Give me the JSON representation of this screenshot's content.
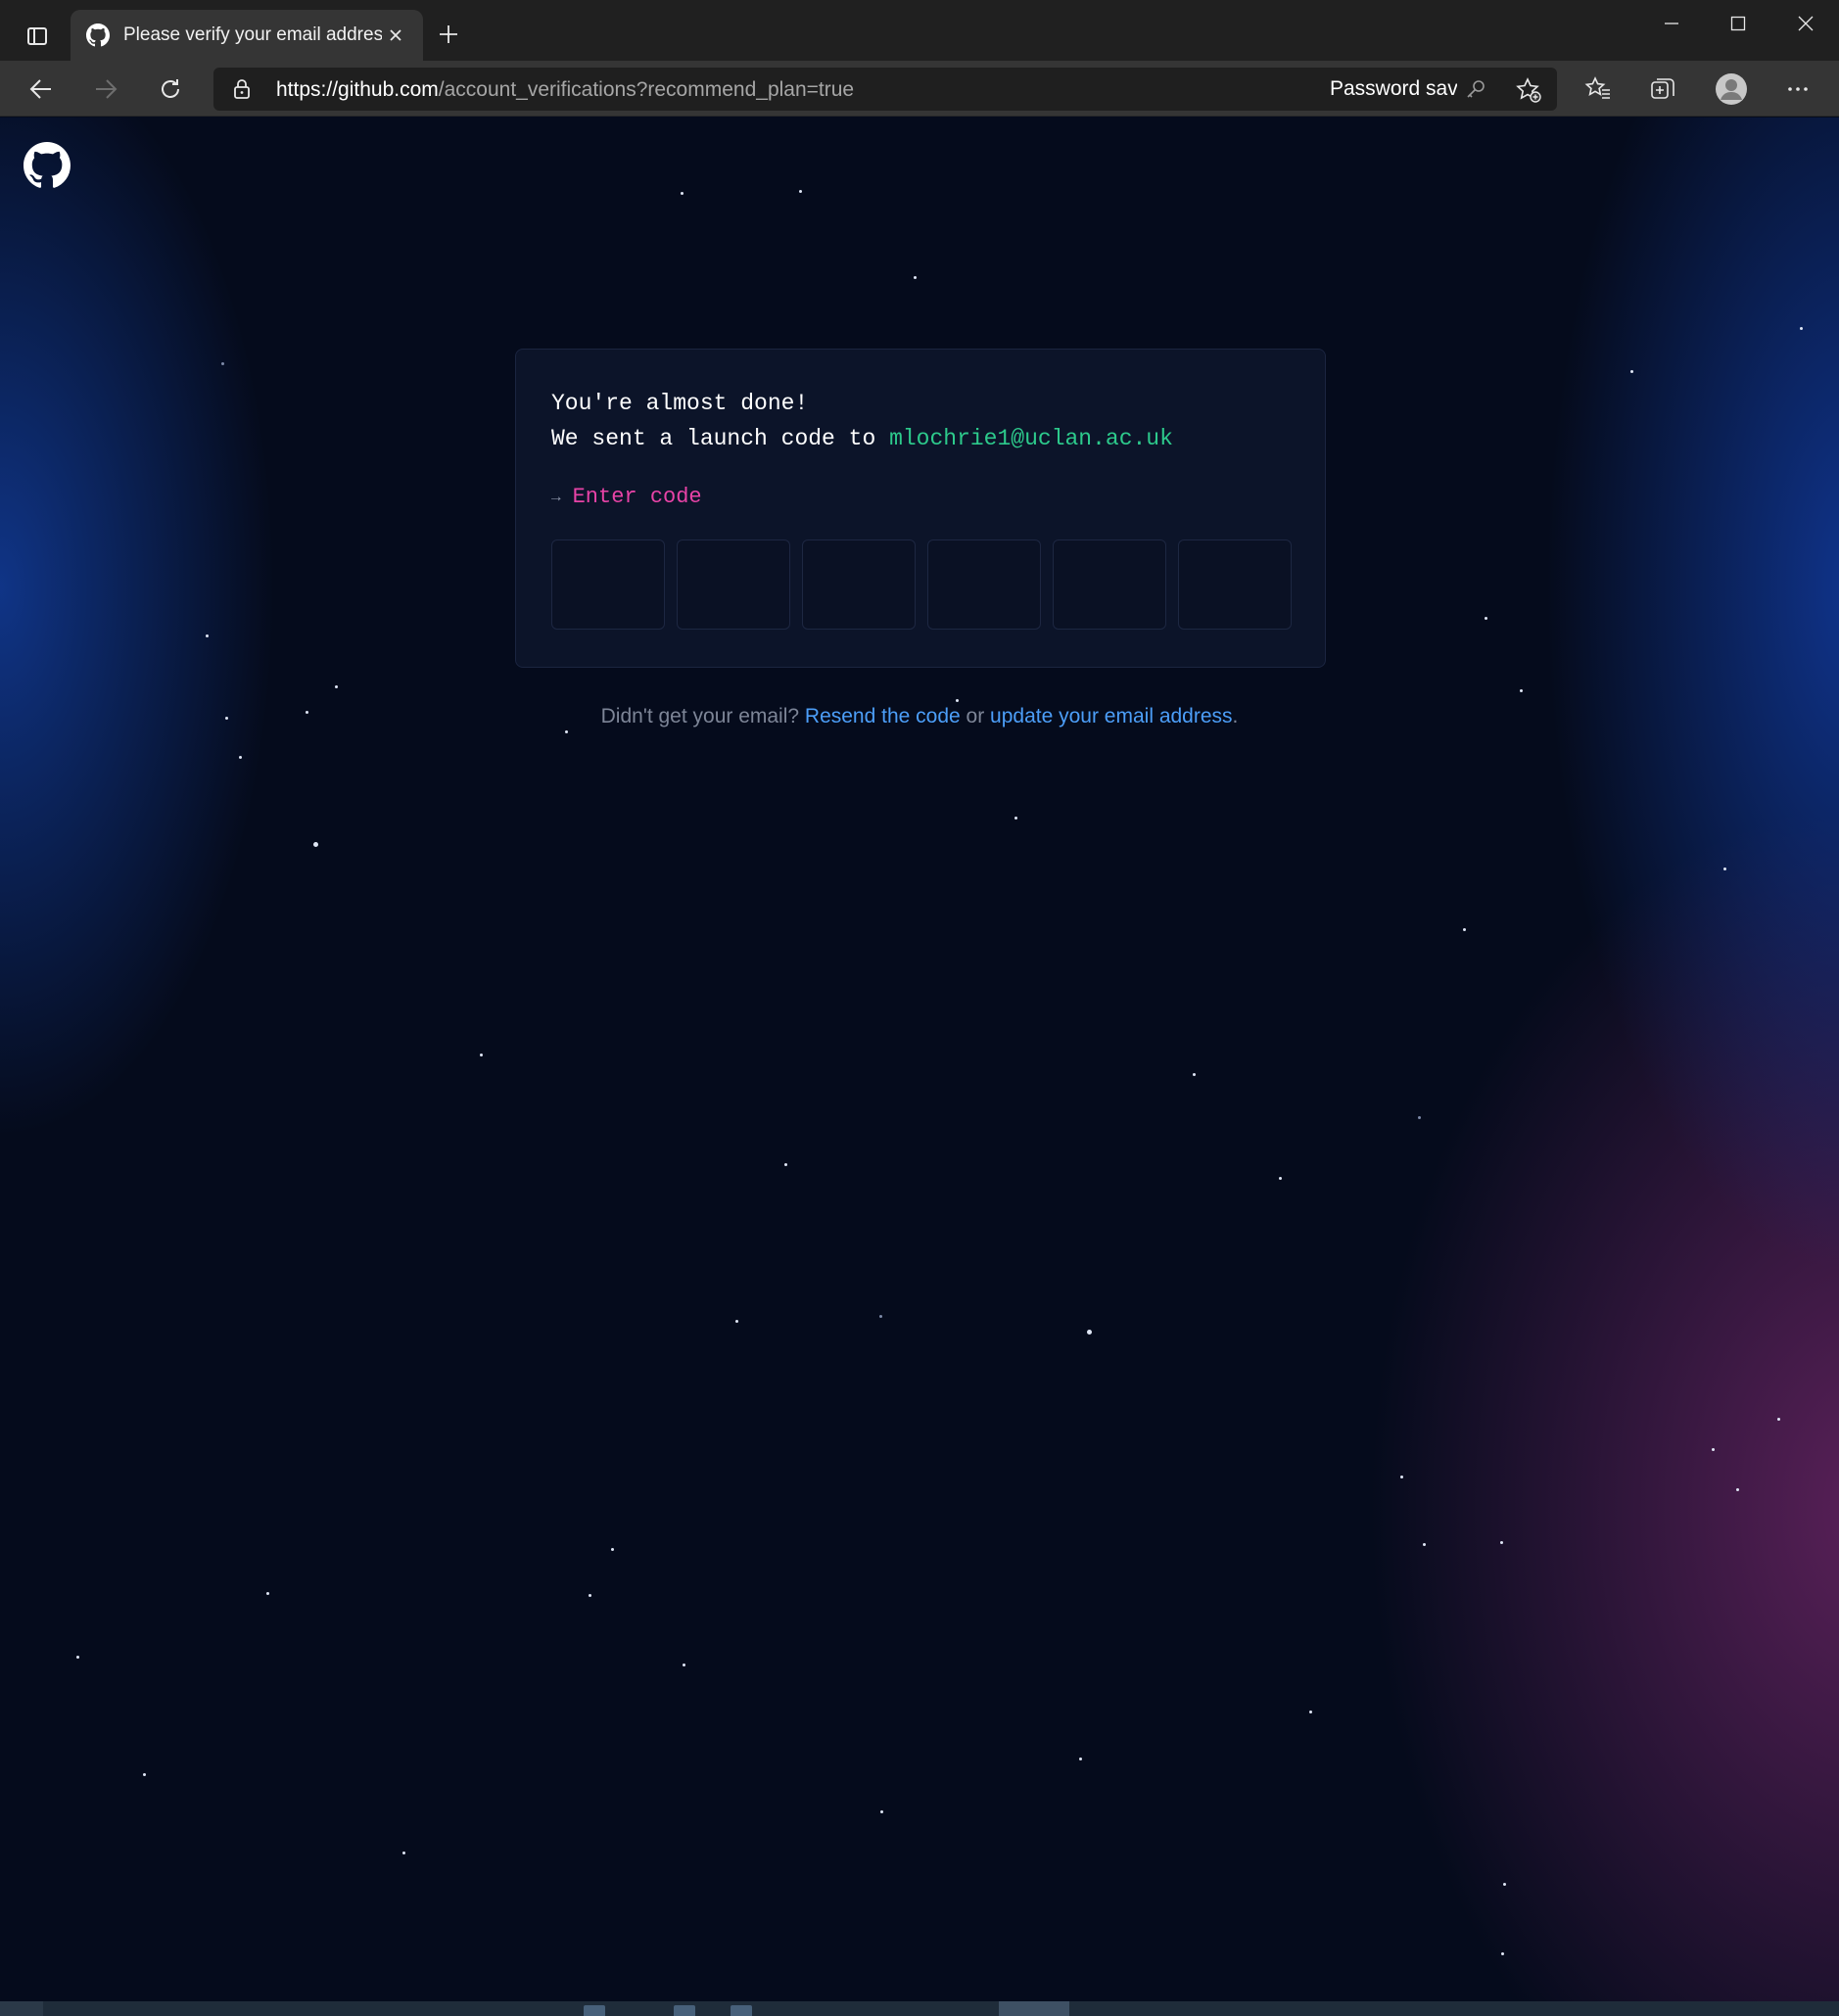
{
  "browser": {
    "tab": {
      "title": "Please verify your email address"
    },
    "address": {
      "scheme": "https://",
      "host": "github.com",
      "path": "/account_verifications?recommend_plan=true"
    },
    "password_saved_label": "Password saved"
  },
  "page": {
    "heading": "You're almost done!",
    "sent_prefix": "We sent a launch code to ",
    "email": "mlochrie1@uclan.ac.uk",
    "enter_code_arrow": "→",
    "enter_code_label": "Enter code",
    "code_digits": [
      "",
      "",
      "",
      "",
      "",
      ""
    ],
    "help": {
      "prefix": "Didn't get your email? ",
      "resend_link": "Resend the code",
      "middle": " or ",
      "update_link": "update your email address",
      "suffix": "."
    }
  },
  "colors": {
    "background": "#050b1c",
    "card": "#0c1429",
    "email_green": "#2dca8c",
    "enter_code_pink": "#e843a7",
    "link_blue": "#4c9ef8"
  }
}
